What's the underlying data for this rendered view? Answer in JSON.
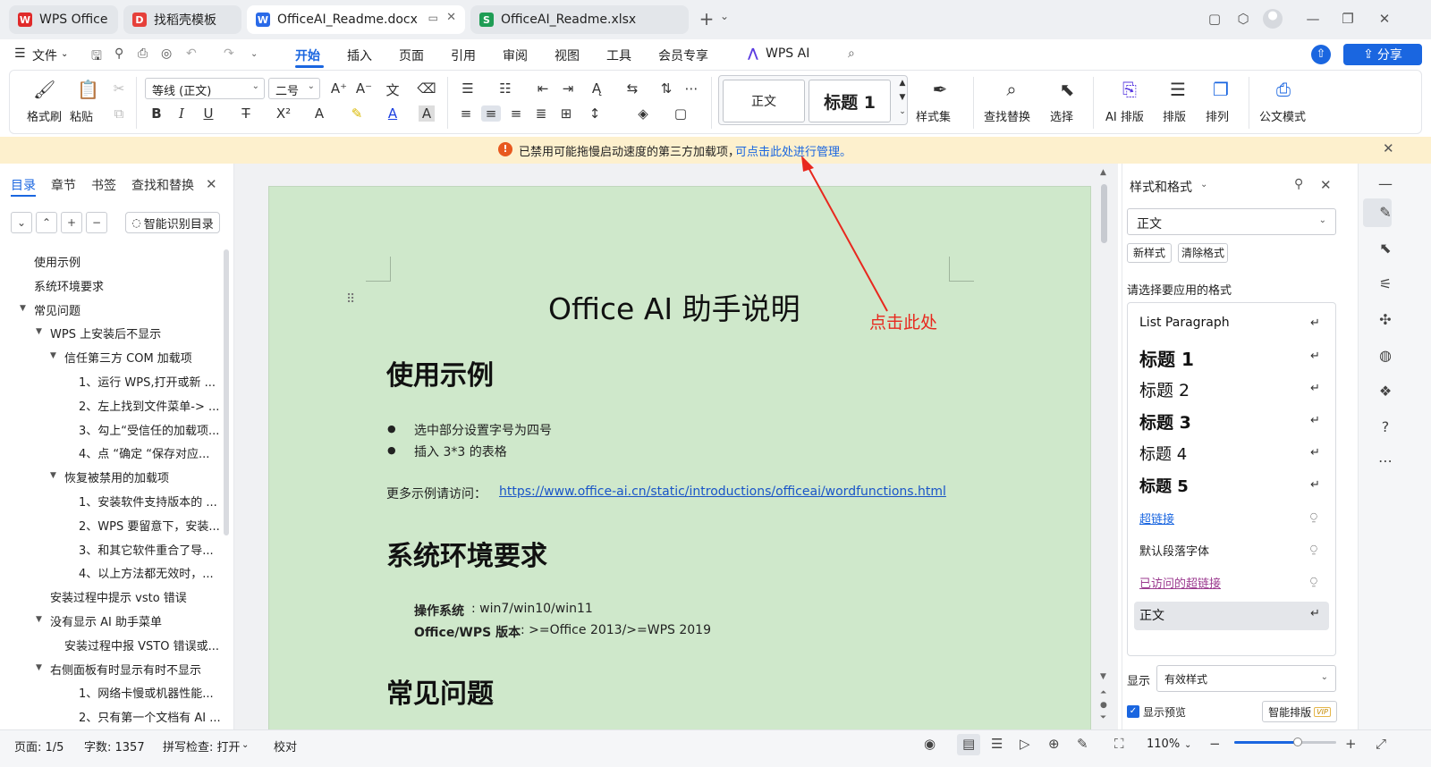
{
  "titlebar": {
    "tabs": [
      {
        "label": "WPS Office",
        "icon": "W",
        "icon_name": "wps-logo-icon"
      },
      {
        "label": "找稻壳模板",
        "icon": "D",
        "icon_name": "docer-icon"
      },
      {
        "label": "OfficeAI_Readme.docx",
        "icon": "W",
        "icon_name": "word-doc-icon"
      },
      {
        "label": "OfficeAI_Readme.xlsx",
        "icon": "S",
        "icon_name": "sheet-icon"
      }
    ],
    "new_tab": "+",
    "new_tab_dropdown": "⌄"
  },
  "menubar": {
    "file": "文件",
    "items": [
      "开始",
      "插入",
      "页面",
      "引用",
      "审阅",
      "视图",
      "工具",
      "会员专享"
    ],
    "ai": "WPS AI",
    "share": "分享"
  },
  "ribbon": {
    "format_painter": "格式刷",
    "paste": "粘贴",
    "font_name": "等线 (正文)",
    "font_size": "二号",
    "style_normal": "正文",
    "style_heading1": "标题  1",
    "style_set": "样式集",
    "find_replace": "查找替换",
    "select": "选择",
    "ai_layout": "AI 排版",
    "layout": "排版",
    "arrange": "排列",
    "official_doc": "公文模式"
  },
  "notification": {
    "text": "已禁用可能拖慢启动速度的第三方加载项，",
    "link": "可点击此处进行管理。",
    "annotation": "点击此处"
  },
  "leftpane": {
    "tabs": [
      "目录",
      "章节",
      "书签",
      "查找和替换"
    ],
    "smart_toc": "智能识别目录",
    "toc": [
      {
        "t": "使用示例",
        "lvl": 1
      },
      {
        "t": "系统环境要求",
        "lvl": 1
      },
      {
        "t": "常见问题",
        "lvl": 1
      },
      {
        "t": "WPS 上安装后不显示",
        "lvl": 2
      },
      {
        "t": "信任第三方 COM 加载项",
        "lvl": 3
      },
      {
        "t": "1、运行 WPS,打开或新 ...",
        "lvl": 4
      },
      {
        "t": "2、左上找到文件菜单-> ...",
        "lvl": 4
      },
      {
        "t": "3、勾上“受信任的加载项...",
        "lvl": 4
      },
      {
        "t": "4、点 “确定 “保存对应...",
        "lvl": 4
      },
      {
        "t": "恢复被禁用的加载项",
        "lvl": 3
      },
      {
        "t": "1、安装软件支持版本的 ...",
        "lvl": 4
      },
      {
        "t": "2、WPS 要留意下，安装...",
        "lvl": 4
      },
      {
        "t": "3、和其它软件重合了导...",
        "lvl": 4
      },
      {
        "t": "4、以上方法都无效时，...",
        "lvl": 4
      },
      {
        "t": "安装过程中提示 vsto 错误",
        "lvl": 2
      },
      {
        "t": "没有显示 AI 助手菜单",
        "lvl": 2
      },
      {
        "t": "安装过程中报 VSTO 错误或...",
        "lvl": 3
      },
      {
        "t": "右侧面板有时显示有时不显示",
        "lvl": 2
      },
      {
        "t": "1、网络卡慢或机器性能...",
        "lvl": 4
      },
      {
        "t": "2、只有第一个文档有 AI ...",
        "lvl": 4
      }
    ]
  },
  "document": {
    "title": "Office AI 助手说明",
    "h1": "使用示例",
    "bullets": [
      "选中部分设置字号为四号",
      "插入 3*3 的表格"
    ],
    "more_label": "更多示例请访问：",
    "more_link": "https://www.office-ai.cn/static/introductions/officeai/wordfunctions.html",
    "h2": "系统环境要求",
    "os_label": "操作系统",
    "os_value": ": win7/win10/win11",
    "ver_label": "Office/WPS 版本",
    "ver_value": ": >=Office 2013/>=WPS 2019",
    "h3": "常见问题"
  },
  "rightpane": {
    "title": "样式和格式",
    "current_style": "正文",
    "new_style": "新样式",
    "clear_format": "清除格式",
    "prompt": "请选择要应用的格式",
    "styles": [
      "List Paragraph",
      "标题  1",
      "标题  2",
      "标题  3",
      "标题  4",
      "标题  5",
      "超链接",
      "默认段落字体",
      "已访问的超链接",
      "正文"
    ],
    "show_label": "显示",
    "show_value": "有效样式",
    "preview_label": "显示预览",
    "smart_layout": "智能排版",
    "vip": "VIP"
  },
  "status": {
    "page": "页面: 1/5",
    "words": "字数: 1357",
    "spell": "拼写检查: 打开",
    "proof": "校对",
    "zoom": "110%",
    "zoom_level": 0.62
  },
  "colors": {
    "accent": "#1a66e0",
    "page_bg": "#cfe8cb",
    "notify_bg": "#fdf0cd",
    "annotation": "#e8281e"
  }
}
